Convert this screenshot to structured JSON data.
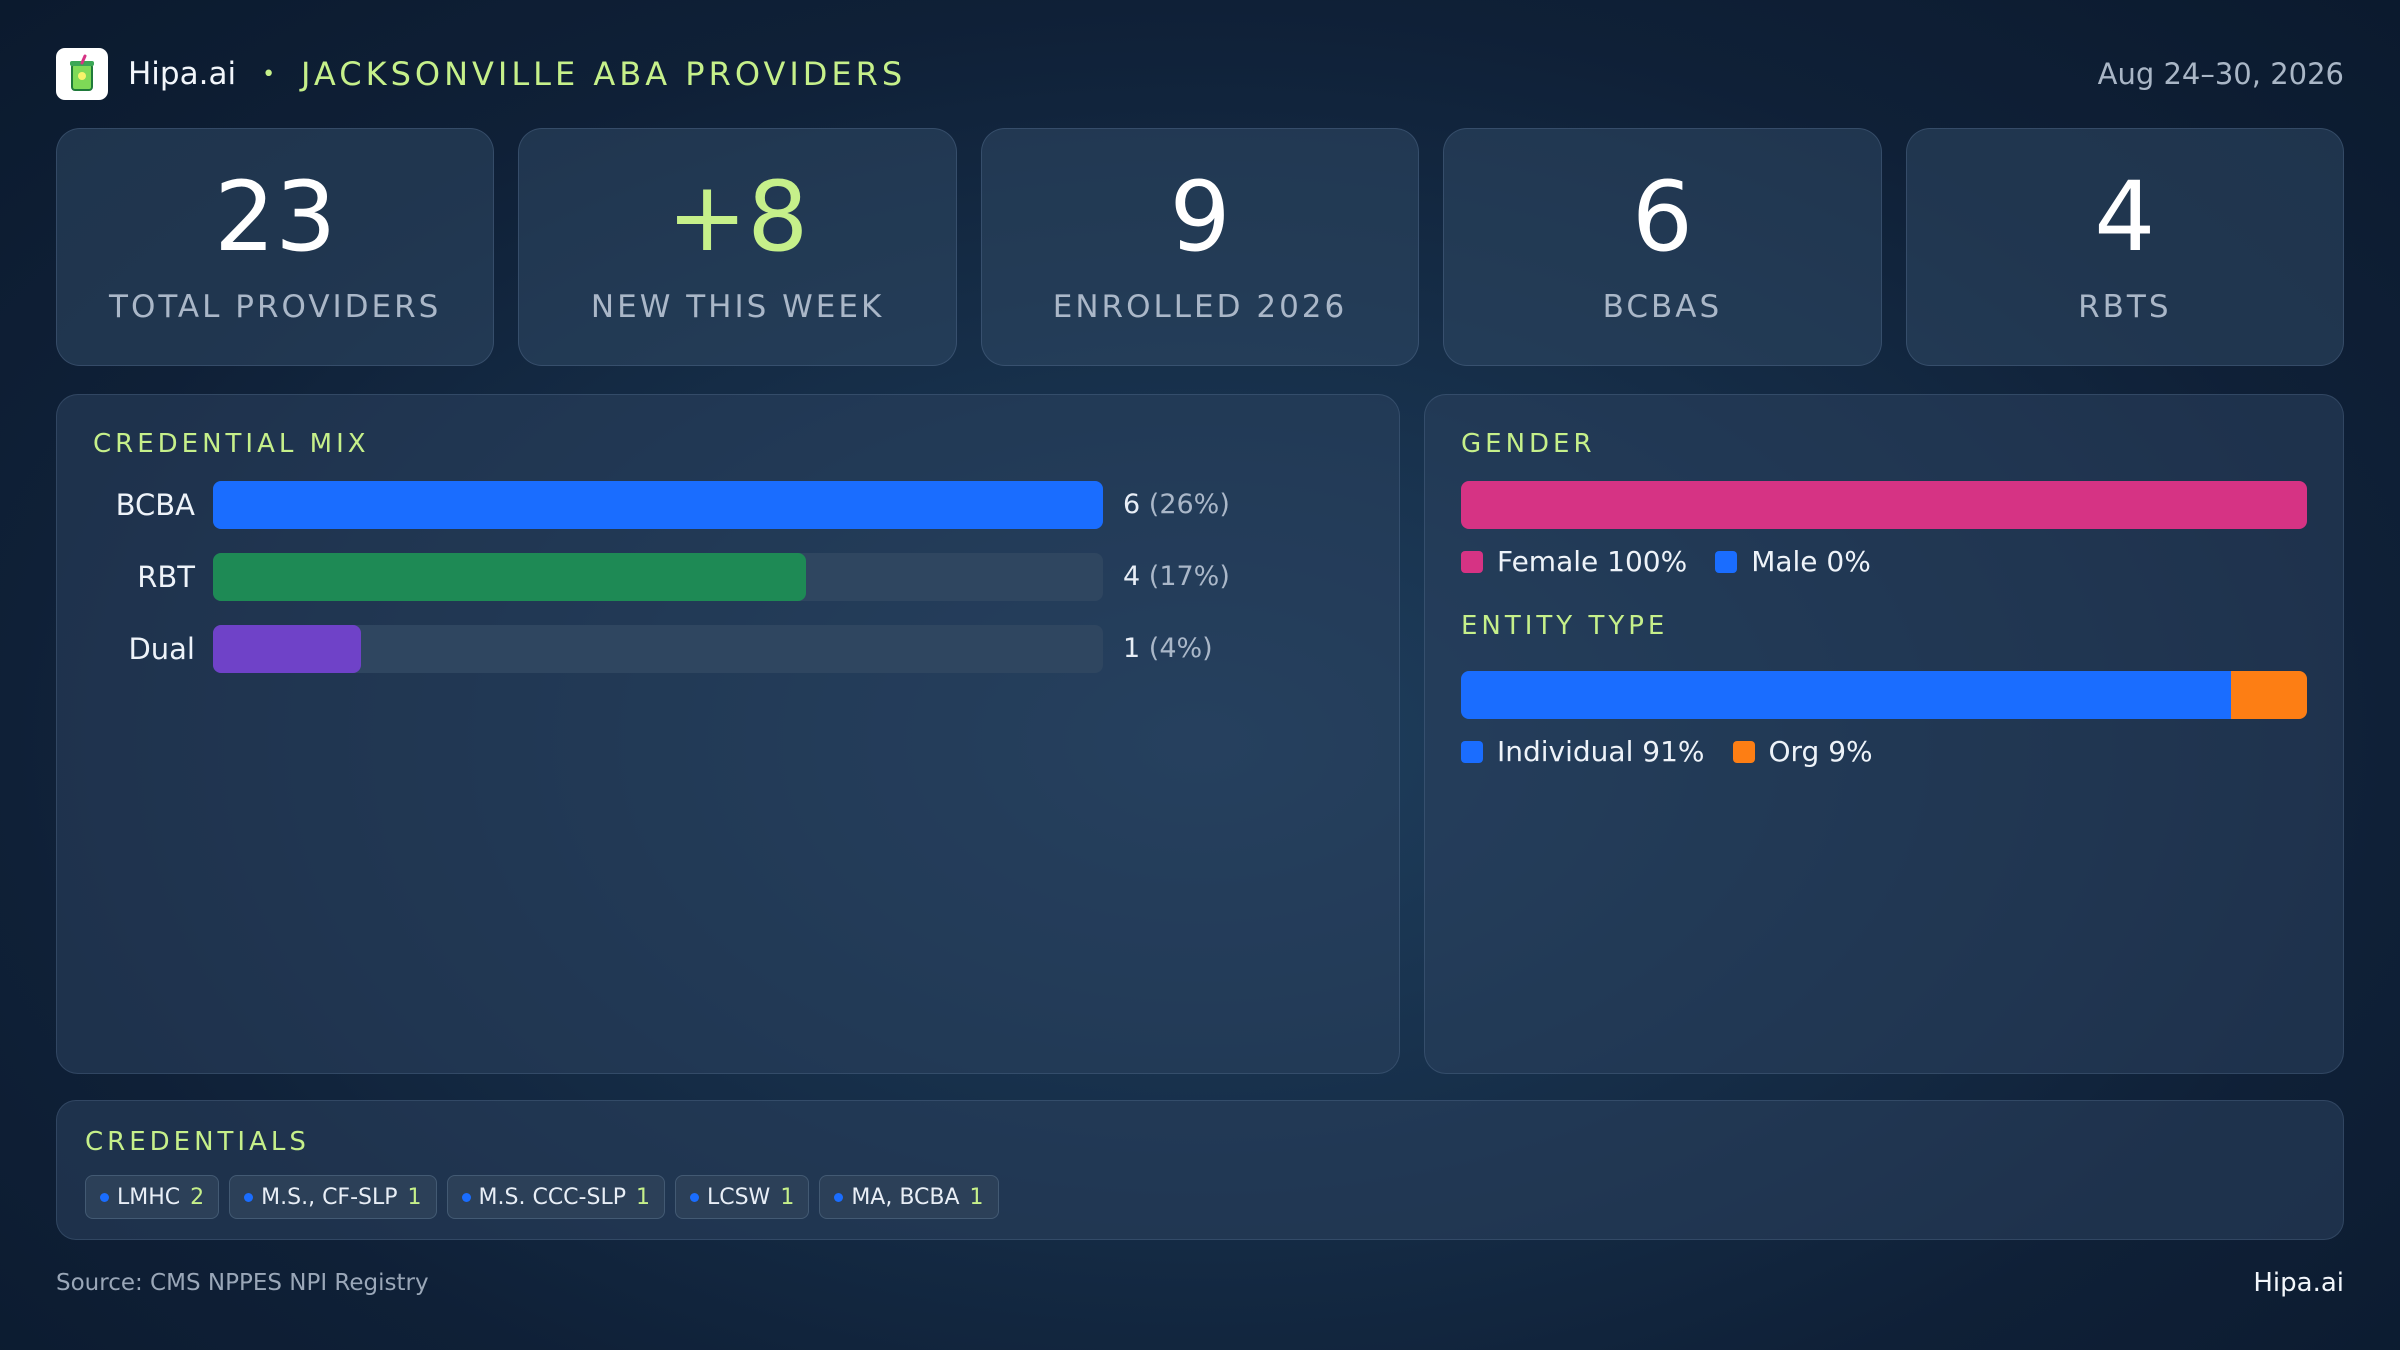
{
  "header": {
    "brand": "Hipa.ai",
    "separator": "•",
    "title": "JACKSONVILLE ABA PROVIDERS",
    "date_range": "Aug 24–30, 2026",
    "logo_icon": "drink-cup-icon"
  },
  "stats": [
    {
      "value": "23",
      "label": "TOTAL PROVIDERS"
    },
    {
      "value": "+8",
      "label": "NEW THIS WEEK"
    },
    {
      "value": "9",
      "label": "ENROLLED 2026"
    },
    {
      "value": "6",
      "label": "BCBAS"
    },
    {
      "value": "4",
      "label": "RBTS"
    }
  ],
  "credential_mix": {
    "title": "CREDENTIAL MIX",
    "rows": [
      {
        "label": "BCBA",
        "count": "6",
        "pct": "(26%)",
        "color": "#1a6dff"
      },
      {
        "label": "RBT",
        "count": "4",
        "pct": "(17%)",
        "color": "#1e8a55"
      },
      {
        "label": "Dual",
        "count": "1",
        "pct": "(4%)",
        "color": "#6f42c8"
      }
    ]
  },
  "gender": {
    "title": "GENDER",
    "legend": [
      {
        "label": "Female 100%",
        "color": "#d63384"
      },
      {
        "label": "Male 0%",
        "color": "#1a6dff"
      }
    ]
  },
  "entity_type": {
    "title": "ENTITY TYPE",
    "legend": [
      {
        "label": "Individual 91%",
        "color": "#1a6dff"
      },
      {
        "label": "Org 9%",
        "color": "#fd7e14"
      }
    ]
  },
  "credentials": {
    "title": "CREDENTIALS",
    "chips": [
      {
        "label": "LMHC",
        "count": "2"
      },
      {
        "label": "M.S., CF-SLP",
        "count": "1"
      },
      {
        "label": "M.S. CCC-SLP",
        "count": "1"
      },
      {
        "label": "LCSW",
        "count": "1"
      },
      {
        "label": "MA, BCBA",
        "count": "1"
      }
    ]
  },
  "footer": {
    "source": "Source: CMS NPPES NPI Registry",
    "brand": "Hipa.ai"
  },
  "chart_data": [
    {
      "type": "bar",
      "title": "CREDENTIAL MIX",
      "categories": [
        "BCBA",
        "RBT",
        "Dual"
      ],
      "values": [
        6,
        4,
        1
      ],
      "percent_labels": [
        "26%",
        "17%",
        "4%"
      ],
      "xlim": [
        0,
        6
      ]
    },
    {
      "type": "bar",
      "title": "GENDER",
      "categories": [
        "Female",
        "Male"
      ],
      "values": [
        100,
        0
      ]
    },
    {
      "type": "bar",
      "title": "ENTITY TYPE",
      "categories": [
        "Individual",
        "Org"
      ],
      "values": [
        91,
        9
      ]
    }
  ]
}
